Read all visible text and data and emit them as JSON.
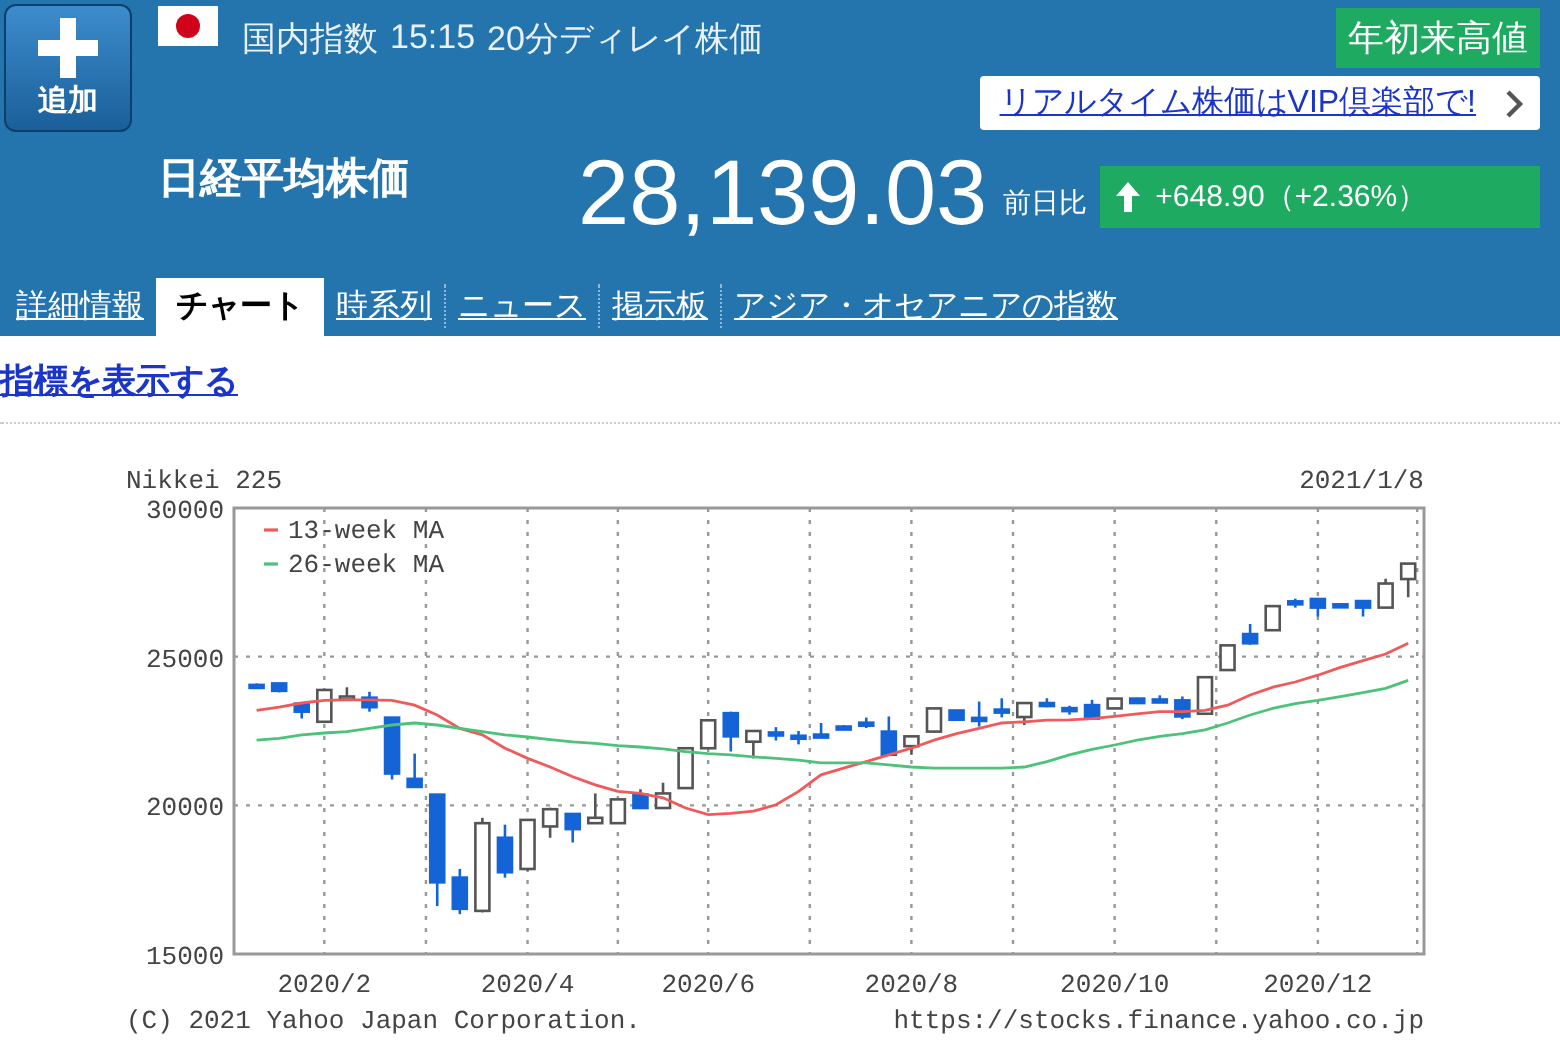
{
  "header": {
    "add_button": "追加",
    "market": "国内指数",
    "time": "15:15",
    "delay_note": "20分ディレイ株価",
    "badge": "年初来高値",
    "promo_link": "リアルタイム株価はVIP倶楽部で!",
    "name": "日経平均株価",
    "price": "28,139.03",
    "change_label": "前日比",
    "change": "+648.90（+2.36%）"
  },
  "tabs": [
    {
      "label": "詳細情報",
      "selected": false
    },
    {
      "label": "チャート",
      "selected": true
    },
    {
      "label": "時系列",
      "selected": false
    },
    {
      "label": "ニュース",
      "selected": false
    },
    {
      "label": "掲示板",
      "selected": false
    },
    {
      "label": "アジア・オセアニアの指数",
      "selected": false
    }
  ],
  "indicator_link": "指標を表示する",
  "chart": {
    "date": "2021/1/8",
    "copyright": "(C) 2021 Yahoo Japan Corporation.",
    "url": "https://stocks.finance.yahoo.co.jp",
    "chart_data": {
      "type": "candlestick",
      "title": "Nikkei 225",
      "categories": [
        null,
        null,
        null,
        "2020/2",
        null,
        null,
        null,
        null,
        null,
        null,
        null,
        null,
        "2020/4",
        null,
        null,
        null,
        null,
        null,
        null,
        null,
        "2020/6",
        null,
        null,
        null,
        null,
        null,
        null,
        null,
        null,
        "2020/8",
        null,
        null,
        null,
        null,
        null,
        null,
        null,
        null,
        "2020/10",
        null,
        null,
        null,
        null,
        null,
        null,
        null,
        null,
        "2020/12",
        null,
        null,
        null,
        null
      ],
      "series": [
        {
          "name": "13-week MA",
          "type": "line",
          "color": "#f05a5a",
          "values": [
            23190,
            23300,
            23440,
            23530,
            23550,
            23550,
            23530,
            23370,
            23040,
            22590,
            22370,
            21920,
            21580,
            21290,
            20960,
            20690,
            20470,
            20400,
            20250,
            19910,
            19690,
            19730,
            19800,
            20020,
            20470,
            21030,
            21250,
            21470,
            21700,
            21920,
            22190,
            22410,
            22590,
            22770,
            22810,
            22860,
            22880,
            22920,
            22990,
            23080,
            23150,
            23150,
            23190,
            23370,
            23710,
            23970,
            24150,
            24380,
            24640,
            24870,
            25090,
            25450
          ]
        },
        {
          "name": "26-week MA",
          "type": "line",
          "color": "#4cc27a",
          "values": [
            22190,
            22250,
            22370,
            22430,
            22480,
            22590,
            22700,
            22770,
            22700,
            22590,
            22480,
            22370,
            22300,
            22210,
            22140,
            22080,
            22010,
            21960,
            21900,
            21810,
            21740,
            21700,
            21630,
            21580,
            21520,
            21430,
            21430,
            21430,
            21360,
            21290,
            21250,
            21250,
            21250,
            21250,
            21290,
            21470,
            21700,
            21880,
            22030,
            22190,
            22320,
            22410,
            22540,
            22770,
            23040,
            23260,
            23420,
            23530,
            23660,
            23790,
            23930,
            24200
          ]
        }
      ],
      "ylim": [
        15000,
        30000
      ],
      "grid": true,
      "legend": "upper left",
      "yticks": [
        15000,
        20000,
        25000,
        30000
      ],
      "ohlc": [
        [
          24050,
          24100,
          23950,
          24000
        ],
        [
          24100,
          24120,
          23800,
          23850
        ],
        [
          23420,
          23450,
          22920,
          23150
        ],
        [
          22810,
          23900,
          22810,
          23880
        ],
        [
          23620,
          23970,
          23600,
          23660
        ],
        [
          23620,
          23820,
          23150,
          23300
        ],
        [
          22950,
          22950,
          20870,
          21070
        ],
        [
          20890,
          21740,
          20620,
          20620
        ],
        [
          20360,
          20360,
          16610,
          17410
        ],
        [
          17570,
          17860,
          16340,
          16520
        ],
        [
          16450,
          19580,
          16400,
          19400
        ],
        [
          18910,
          19350,
          17570,
          17750
        ],
        [
          17860,
          19510,
          17800,
          19510
        ],
        [
          19290,
          19920,
          18910,
          19870
        ],
        [
          19710,
          19710,
          18750,
          19200
        ],
        [
          19400,
          20400,
          19400,
          19580
        ],
        [
          19400,
          20200,
          19400,
          20200
        ],
        [
          20360,
          20540,
          19910,
          19910
        ],
        [
          19910,
          20760,
          19900,
          20400
        ],
        [
          20580,
          21920,
          20580,
          21920
        ],
        [
          21920,
          22860,
          21900,
          22860
        ],
        [
          23100,
          23150,
          21810,
          22320
        ],
        [
          22140,
          22500,
          21580,
          22500
        ],
        [
          22450,
          22630,
          22180,
          22380
        ],
        [
          22340,
          22500,
          22050,
          22300
        ],
        [
          22380,
          22770,
          22350,
          22350
        ],
        [
          22650,
          22700,
          22550,
          22600
        ],
        [
          22780,
          22950,
          22600,
          22760
        ],
        [
          22480,
          22990,
          21700,
          21700
        ],
        [
          21990,
          22320,
          21700,
          22320
        ],
        [
          22480,
          23260,
          22450,
          23260
        ],
        [
          23190,
          23200,
          22880,
          22880
        ],
        [
          22940,
          23490,
          22650,
          22900
        ],
        [
          23220,
          23600,
          22960,
          23200
        ],
        [
          22970,
          23440,
          22700,
          23440
        ],
        [
          23440,
          23600,
          23300,
          23400
        ],
        [
          23270,
          23350,
          23050,
          23250
        ],
        [
          23370,
          23550,
          22920,
          22920
        ],
        [
          23260,
          23590,
          23250,
          23590
        ],
        [
          23590,
          23620,
          23440,
          23440
        ],
        [
          23560,
          23700,
          23450,
          23540
        ],
        [
          23530,
          23660,
          22900,
          22990
        ],
        [
          23080,
          24310,
          23080,
          24310
        ],
        [
          24550,
          25400,
          24550,
          25380
        ],
        [
          25760,
          26100,
          25400,
          25450
        ],
        [
          25890,
          26700,
          25890,
          26700
        ],
        [
          26860,
          26950,
          26650,
          26840
        ],
        [
          26940,
          26950,
          26350,
          26650
        ],
        [
          26760,
          26800,
          26680,
          26740
        ],
        [
          26870,
          26880,
          26350,
          26650
        ],
        [
          26650,
          27620,
          26650,
          27460
        ],
        [
          27610,
          28140,
          27000,
          28130
        ]
      ]
    }
  }
}
